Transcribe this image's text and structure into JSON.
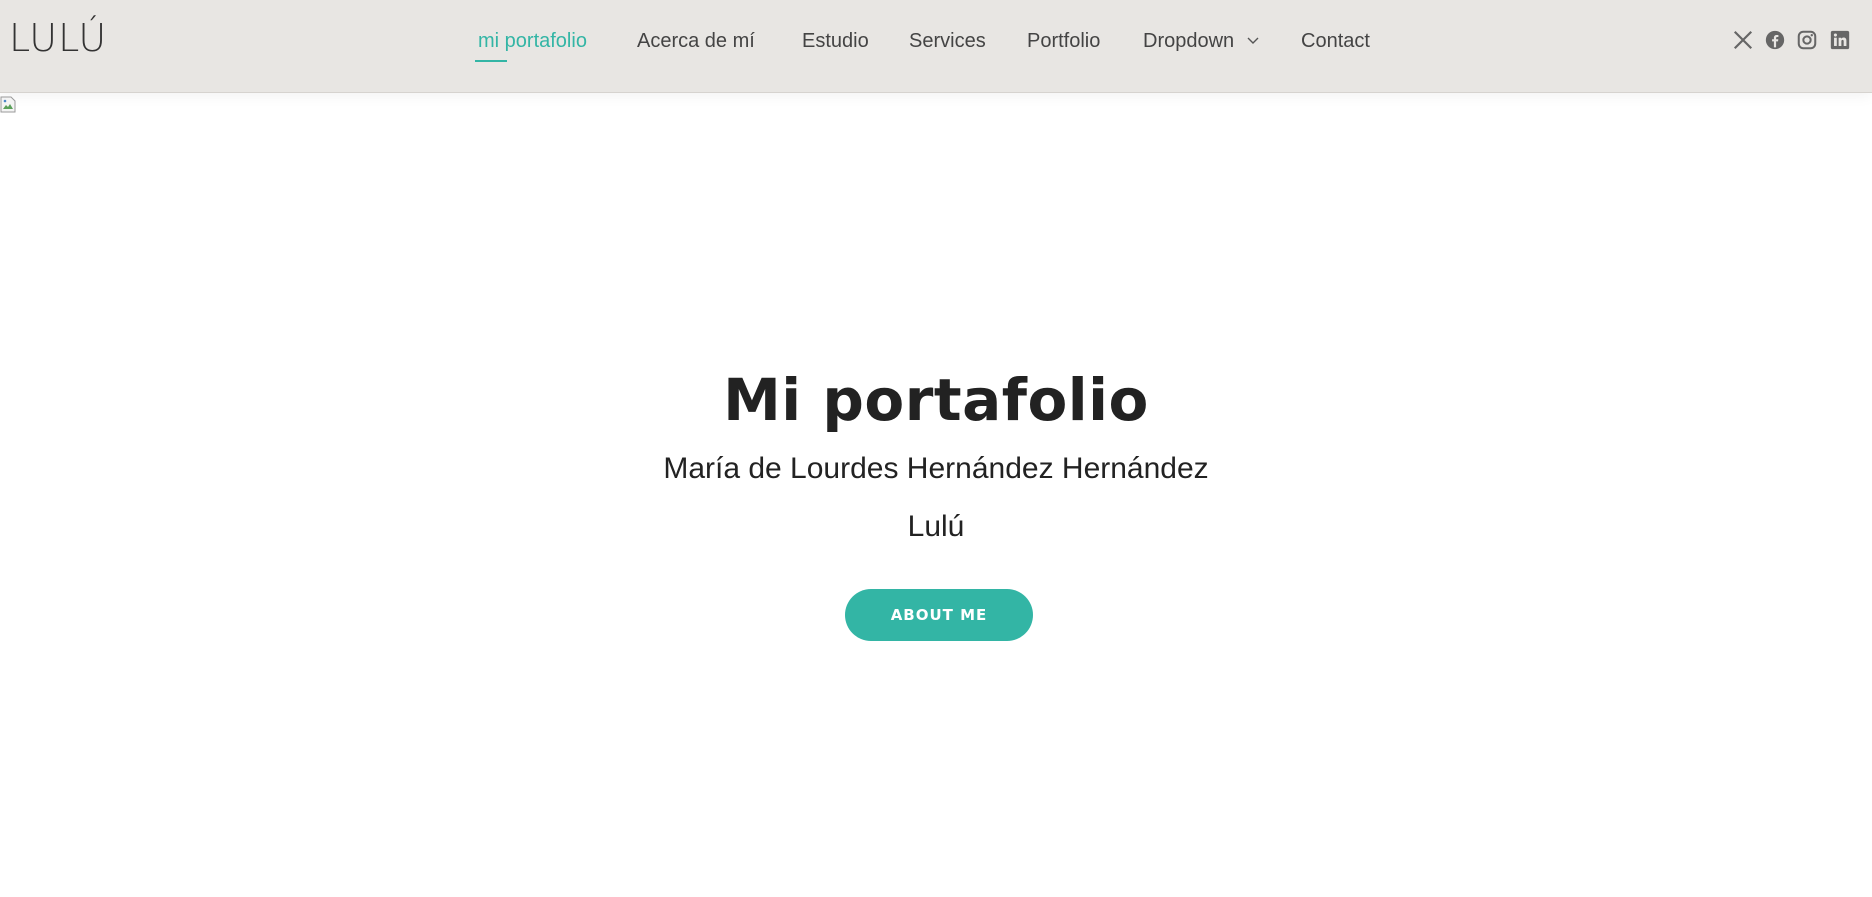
{
  "header": {
    "logo": "LULÚ",
    "nav": [
      {
        "label": "mi portafolio",
        "active": true
      },
      {
        "label": "Acerca de mí"
      },
      {
        "label": "Estudio"
      },
      {
        "label": "Services"
      },
      {
        "label": "Portfolio"
      },
      {
        "label": "Dropdown",
        "has_dropdown": true
      },
      {
        "label": "Contact"
      }
    ],
    "social": [
      "x-icon",
      "facebook-icon",
      "instagram-icon",
      "linkedin-icon"
    ]
  },
  "hero": {
    "title": "Mi portafolio",
    "name": "María de Lourdes Hernández Hernández",
    "nickname": "Lulú",
    "cta_label": "ABOUT ME"
  },
  "colors": {
    "accent": "#33b5a5",
    "header_bg": "#e8e6e3",
    "text": "#222222"
  }
}
